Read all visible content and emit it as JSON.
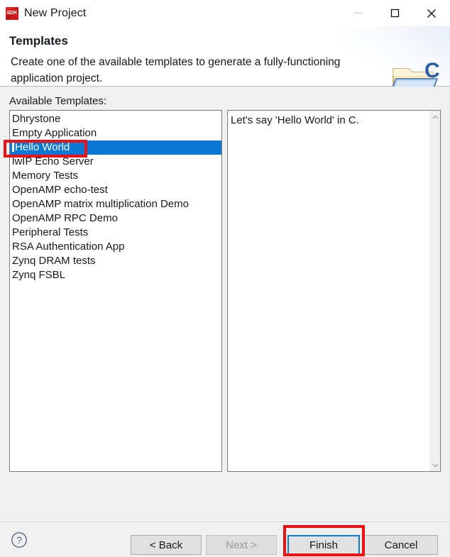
{
  "window": {
    "title": "New Project",
    "app_icon": "sdk-icon",
    "controls": [
      {
        "name": "minimize-button",
        "glyph": "minimize-icon",
        "enabled": false
      },
      {
        "name": "maximize-button",
        "glyph": "maximize-icon",
        "enabled": true
      },
      {
        "name": "close-button",
        "glyph": "close-icon",
        "enabled": true
      }
    ]
  },
  "header": {
    "title": "Templates",
    "description": "Create one of the available templates to generate a fully-functioning application project.",
    "icon": "c-project-folder-icon"
  },
  "main": {
    "list_label": "Available Templates:",
    "templates": [
      {
        "label": "Dhrystone",
        "selected": false
      },
      {
        "label": "Empty Application",
        "selected": false
      },
      {
        "label": "Hello World",
        "selected": true
      },
      {
        "label": "lwIP Echo Server",
        "selected": false
      },
      {
        "label": "Memory Tests",
        "selected": false
      },
      {
        "label": "OpenAMP echo-test",
        "selected": false
      },
      {
        "label": "OpenAMP matrix multiplication Demo",
        "selected": false
      },
      {
        "label": "OpenAMP RPC Demo",
        "selected": false
      },
      {
        "label": "Peripheral Tests",
        "selected": false
      },
      {
        "label": "RSA Authentication App",
        "selected": false
      },
      {
        "label": "Zynq DRAM tests",
        "selected": false
      },
      {
        "label": "Zynq FSBL",
        "selected": false
      }
    ],
    "description_panel": {
      "text": "Let's say 'Hello World' in C.",
      "scrollbar": {
        "up_icon": "chevron-up-icon",
        "down_icon": "chevron-down-icon"
      }
    }
  },
  "footer": {
    "help_icon": "help-question-icon",
    "buttons": [
      {
        "name": "back-button",
        "label": "< Back",
        "enabled": true,
        "default": false
      },
      {
        "name": "next-button",
        "label": "Next >",
        "enabled": false,
        "default": false
      },
      {
        "name": "finish-button",
        "label": "Finish",
        "enabled": true,
        "default": true
      },
      {
        "name": "cancel-button",
        "label": "Cancel",
        "enabled": true,
        "default": false
      }
    ]
  },
  "annotations": {
    "color": "#ee1111",
    "highlighted": [
      "template-hello-world",
      "finish-button"
    ]
  },
  "colors": {
    "selection_blue": "#0a78d4",
    "annotation_red": "#ee1111",
    "dialog_background": "#f0f0f0",
    "panel_background": "#ffffff"
  }
}
